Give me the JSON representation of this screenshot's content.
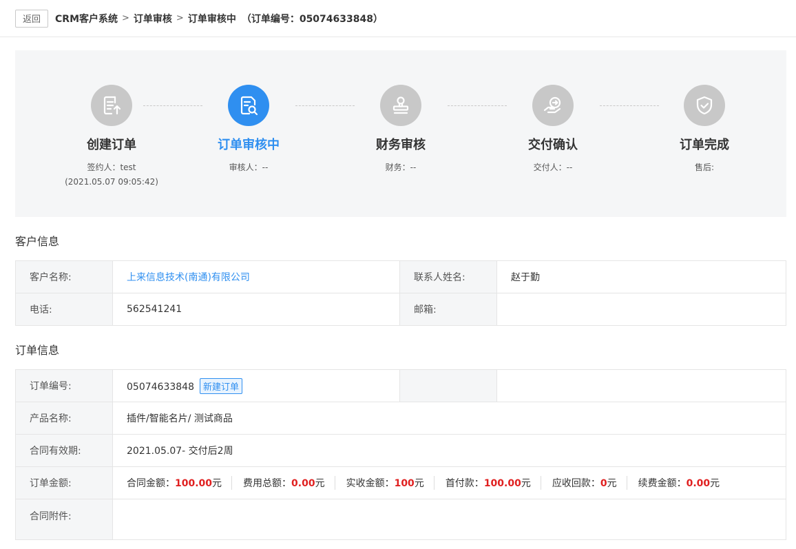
{
  "header": {
    "back_label": "返回",
    "breadcrumb": [
      "CRM客户系统",
      "订单审核",
      "订单审核中"
    ],
    "order_number_text": "（订单编号：05074633848）"
  },
  "steps": [
    {
      "title": "创建订单",
      "line1": "签约人：test",
      "line2": "(2021.05.07 09:05:42)",
      "icon": "document-upload-icon",
      "active": false
    },
    {
      "title": "订单审核中",
      "line1": "审核人：--",
      "line2": "",
      "icon": "document-search-icon",
      "active": true
    },
    {
      "title": "财务审核",
      "line1": "财务：--",
      "line2": "",
      "icon": "stamp-icon",
      "active": false
    },
    {
      "title": "交付确认",
      "line1": "交付人：--",
      "line2": "",
      "icon": "hand-transfer-icon",
      "active": false
    },
    {
      "title": "订单完成",
      "line1": "售后:",
      "line2": "",
      "icon": "shield-check-icon",
      "active": false
    }
  ],
  "customer": {
    "section_title": "客户信息",
    "name_label": "客户名称:",
    "name_value": "上来信息技术(南通)有限公司",
    "contact_label": "联系人姓名:",
    "contact_value": "赵于勤",
    "phone_label": "电话:",
    "phone_value": "562541241",
    "email_label": "邮箱:",
    "email_value": ""
  },
  "order": {
    "section_title": "订单信息",
    "number_label": "订单编号:",
    "number_value": "05074633848",
    "status_tag": "新建订单",
    "product_label": "产品名称:",
    "product_value": "插件/智能名片/ 测试商品",
    "validity_label": "合同有效期:",
    "validity_value": "2021.05.07- 交付后2周",
    "amount_label": "订单金额:",
    "amounts": [
      {
        "label": "合同金额：",
        "value": "100.00",
        "unit": "元"
      },
      {
        "label": "费用总额：",
        "value": "0.00",
        "unit": "元"
      },
      {
        "label": "实收金额：",
        "value": "100",
        "unit": "元"
      },
      {
        "label": "首付款：",
        "value": "100.00",
        "unit": "元"
      },
      {
        "label": "应收回款：",
        "value": "0",
        "unit": "元"
      },
      {
        "label": "续费金额：",
        "value": "0.00",
        "unit": "元"
      }
    ],
    "attachment_label": "合同附件:"
  },
  "colors": {
    "accent": "#2f8ff0",
    "amount_red": "#e02020",
    "inactive_step": "#c8c8c8",
    "panel_bg": "#f5f6f7"
  }
}
